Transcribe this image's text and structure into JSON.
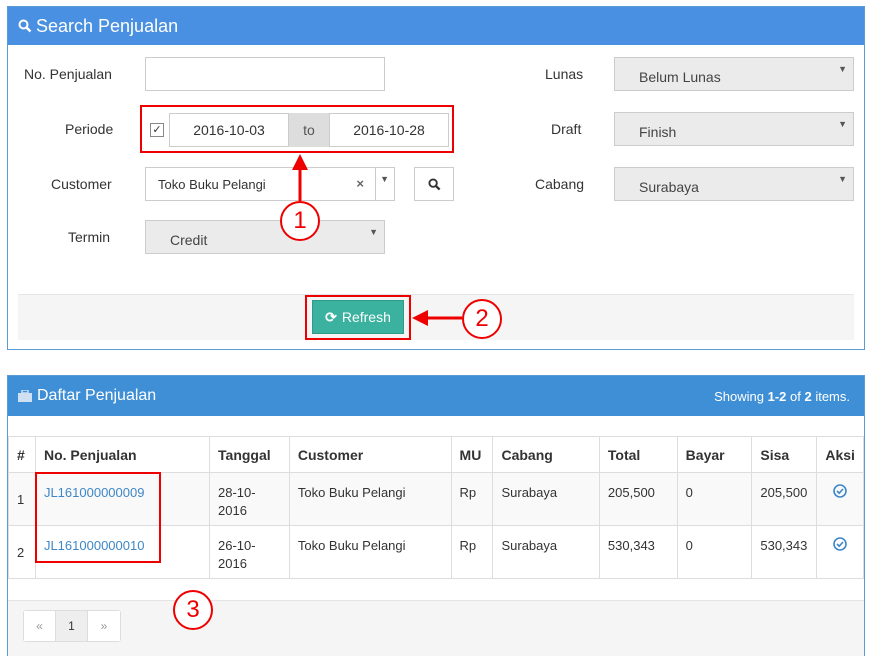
{
  "search_panel": {
    "title": "Search Penjualan",
    "no_penjualan_label": "No. Penjualan",
    "no_penjualan_value": "",
    "periode_label": "Periode",
    "periode_from": "2016-10-03",
    "periode_to_label": "to",
    "periode_to": "2016-10-28",
    "customer_label": "Customer",
    "customer_value": "Toko Buku Pelangi",
    "termin_label": "Termin",
    "termin_value": "Credit",
    "lunas_label": "Lunas",
    "lunas_value": "Belum Lunas",
    "draft_label": "Draft",
    "draft_value": "Finish",
    "cabang_label": "Cabang",
    "cabang_value": "Surabaya",
    "refresh_label": "Refresh"
  },
  "list_panel": {
    "title": "Daftar Penjualan",
    "showing_prefix": "Showing ",
    "showing_range": "1-2",
    "showing_of": " of ",
    "showing_total": "2",
    "showing_suffix": " items.",
    "columns": [
      "#",
      "No. Penjualan",
      "Tanggal",
      "Customer",
      "MU",
      "Cabang",
      "Total",
      "Bayar",
      "Sisa",
      "Aksi"
    ],
    "rows": [
      {
        "num": "1",
        "no": "JL161000000009",
        "tanggal": "28-10-2016",
        "customer": "Toko Buku Pelangi",
        "mu": "Rp",
        "cabang": "Surabaya",
        "total": "205,500",
        "bayar": "0",
        "sisa": "205,500"
      },
      {
        "num": "2",
        "no": "JL161000000010",
        "tanggal": "26-10-2016",
        "customer": "Toko Buku Pelangi",
        "mu": "Rp",
        "cabang": "Surabaya",
        "total": "530,343",
        "bayar": "0",
        "sisa": "530,343"
      }
    ],
    "pager": {
      "prev": "«",
      "page": "1",
      "next": "»"
    }
  },
  "annotations": {
    "one": "1",
    "two": "2",
    "three": "3"
  },
  "icons": {
    "search": "search-icon",
    "refresh": "refresh-icon",
    "briefcase": "briefcase-icon",
    "check": "check-circle-icon",
    "clear": "clear-x-icon",
    "caret": "caret-down-icon"
  }
}
